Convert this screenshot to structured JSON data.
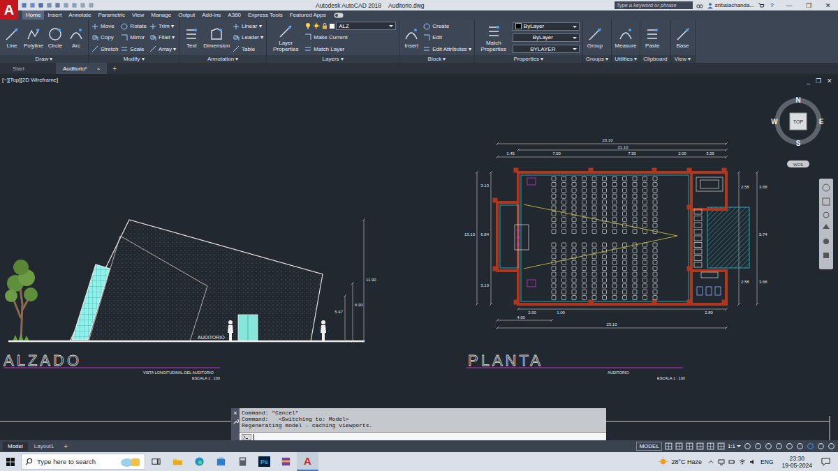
{
  "titlebar": {
    "logo": "A",
    "app_name": "Autodesk AutoCAD 2018",
    "file_name": "Auditorio.dwg",
    "search_placeholder": "Type a keyword or phrase",
    "user": "sribalachanda...",
    "help": "?",
    "controls": [
      "—",
      "❐",
      "✕"
    ]
  },
  "ribbon_tabs": [
    {
      "label": "Home",
      "selected": true
    },
    {
      "label": "Insert",
      "selected": false
    },
    {
      "label": "Annotate",
      "selected": false
    },
    {
      "label": "Parametric",
      "selected": false
    },
    {
      "label": "View",
      "selected": false
    },
    {
      "label": "Manage",
      "selected": false
    },
    {
      "label": "Output",
      "selected": false
    },
    {
      "label": "Add-ins",
      "selected": false
    },
    {
      "label": "A360",
      "selected": false
    },
    {
      "label": "Express Tools",
      "selected": false
    },
    {
      "label": "Featured Apps",
      "selected": false
    }
  ],
  "ribbon_panels": [
    {
      "title": "Draw ▾",
      "columns": [
        [
          {
            "label": "Line",
            "kind": "large"
          }
        ],
        [
          {
            "label": "Polyline",
            "kind": "large"
          }
        ],
        [
          {
            "label": "Circle",
            "kind": "large"
          }
        ],
        [
          {
            "label": "Arc",
            "kind": "large"
          }
        ]
      ]
    },
    {
      "title": "Modify ▾",
      "columns": [
        [
          {
            "label": "Move",
            "kind": "small"
          },
          {
            "label": "Copy",
            "kind": "small"
          },
          {
            "label": "Stretch",
            "kind": "small"
          }
        ],
        [
          {
            "label": "Rotate",
            "kind": "small"
          },
          {
            "label": "Mirror",
            "kind": "small"
          },
          {
            "label": "Scale",
            "kind": "small"
          }
        ],
        [
          {
            "label": "Trim ▾",
            "kind": "small"
          },
          {
            "label": "Fillet ▾",
            "kind": "small"
          },
          {
            "label": "Array ▾",
            "kind": "small"
          }
        ]
      ]
    },
    {
      "title": "Annotation ▾",
      "columns": [
        [
          {
            "label": "Text",
            "kind": "large"
          }
        ],
        [
          {
            "label": "Dimension",
            "kind": "large"
          }
        ],
        [
          {
            "label": "Linear ▾",
            "kind": "small"
          },
          {
            "label": "Leader ▾",
            "kind": "small"
          },
          {
            "label": "Table",
            "kind": "small"
          }
        ]
      ]
    },
    {
      "title": "Layers ▾",
      "columns": [
        [
          {
            "label": "Layer Properties",
            "kind": "large"
          }
        ],
        [
          {
            "label": "ALZ",
            "kind": "layer"
          },
          {
            "label": "Make Current",
            "kind": "small"
          },
          {
            "label": "Match Layer",
            "kind": "small"
          }
        ]
      ]
    },
    {
      "title": "Block ▾",
      "columns": [
        [
          {
            "label": "Insert",
            "kind": "large"
          }
        ],
        [
          {
            "label": "Create",
            "kind": "small"
          },
          {
            "label": "Edit",
            "kind": "small"
          },
          {
            "label": "Edit Attributes ▾",
            "kind": "small"
          }
        ]
      ]
    },
    {
      "title": "Properties ▾",
      "columns": [
        [
          {
            "label": "Match Properties",
            "kind": "large"
          }
        ],
        [
          {
            "label": "ByLayer",
            "kind": "swatch"
          },
          {
            "label": "ByLayer",
            "kind": "dropdown"
          },
          {
            "label": "BYLAYER",
            "kind": "dropdown"
          }
        ]
      ]
    },
    {
      "title": "Groups ▾",
      "columns": [
        [
          {
            "label": "Group",
            "kind": "large"
          }
        ]
      ]
    },
    {
      "title": "Utilities ▾",
      "columns": [
        [
          {
            "label": "Measure",
            "kind": "large"
          }
        ]
      ]
    },
    {
      "title": "Clipboard",
      "columns": [
        [
          {
            "label": "Paste",
            "kind": "large"
          }
        ]
      ]
    },
    {
      "title": "View ▾",
      "columns": [
        [
          {
            "label": "Base",
            "kind": "large"
          }
        ]
      ]
    }
  ],
  "document_tabs": {
    "tabs": [
      {
        "label": "Start",
        "selected": false
      },
      {
        "label": "Auditorio*",
        "selected": true
      }
    ],
    "close": "×",
    "add": "+"
  },
  "viewport": {
    "label": "[−][Top][2D Wireframe]",
    "controls": [
      "_",
      "❐",
      "✕"
    ]
  },
  "viewcube": {
    "north": "N",
    "south": "S",
    "east": "E",
    "west": "W",
    "face": "TOP",
    "ucs": "WCS"
  },
  "drawing": {
    "elevation": {
      "title": "ALZADO",
      "subtitle": "VISTA LONGITUDINAL DEL AUDITORIO",
      "scale": "ESCALA 1 : 100",
      "label": "AUDITORIO",
      "dimensions": [
        "11.90",
        "6.90",
        "5.47"
      ]
    },
    "plan": {
      "title": "PLANTA",
      "subtitle": "AUDITORIO",
      "scale": "ESCALA 1 : 100",
      "dimensions": [
        "23.10",
        "21.10",
        "1.45",
        "7.50",
        "7.50",
        "2.00",
        "3.55",
        "3.13",
        "13.10",
        "6.84",
        "3.13",
        "2.58",
        "3.68",
        "5.74",
        "2.58",
        "3.68",
        "2.00",
        "4.00",
        "1.00",
        "2.80",
        "23.10"
      ]
    }
  },
  "command_line": {
    "history": [
      "Command: \"Cancel\"",
      "Command:   <Switching to: Model>",
      "Regenerating model - caching viewports."
    ],
    "close": "×"
  },
  "layout_tabs": {
    "tabs": [
      {
        "label": "Model",
        "selected": true
      },
      {
        "label": "Layout1",
        "selected": false
      }
    ],
    "add": "+"
  },
  "status_bar": {
    "space": "MODEL",
    "scale": "1:1"
  },
  "taskbar": {
    "search_placeholder": "Type here to search",
    "apps": [
      {
        "glyph": "Ps",
        "kind": "badge",
        "active": false
      },
      {
        "glyph": "A",
        "kind": "letter",
        "active": true
      }
    ],
    "weather": "28°C Haze",
    "language": "ENG",
    "time": "23:30",
    "date": "19-05-2024"
  }
}
